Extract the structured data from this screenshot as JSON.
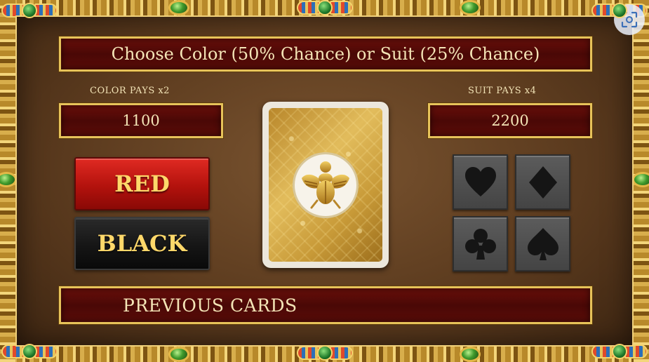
{
  "title": "Choose Color (50% Chance) or Suit (25% Chance)",
  "color": {
    "label": "COLOR PAYS x2",
    "value": "1100",
    "red_label": "RED",
    "black_label": "BLACK"
  },
  "suit": {
    "label": "SUIT PAYS x4",
    "value": "2200",
    "options": [
      {
        "name": "hearts",
        "icon": "heart-icon"
      },
      {
        "name": "diamonds",
        "icon": "diamond-icon"
      },
      {
        "name": "clubs",
        "icon": "club-icon"
      },
      {
        "name": "spades",
        "icon": "spade-icon"
      }
    ]
  },
  "card": {
    "back_icon": "scarab-icon"
  },
  "previous_cards": {
    "label": "PREVIOUS CARDS"
  },
  "colors": {
    "bar_red": "#4a0806",
    "gold": "#e7c35a",
    "red_button": "#c0140f",
    "black_button": "#141414",
    "suit_button": "#4e4e4e",
    "label_text": "#ffd86a"
  }
}
